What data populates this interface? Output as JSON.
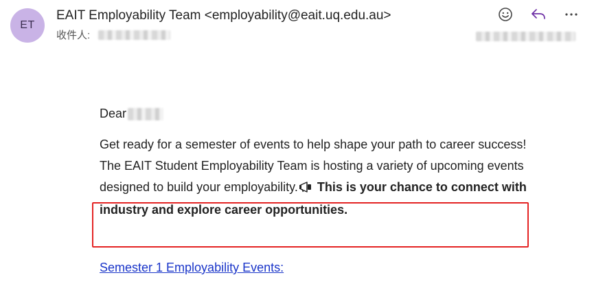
{
  "header": {
    "avatar_initials": "ET",
    "avatar_color": "#c9b3e6",
    "sender": "EAIT Employability Team <employability@eait.uq.edu.au>",
    "recipient_label": "收件人:"
  },
  "toolbar": {
    "icons": [
      "emoji-icon",
      "reply-icon",
      "more-icon"
    ]
  },
  "body": {
    "greeting": "Dear",
    "intro": "Get ready for a semester of events to help shape your path to career success! The EAIT Student Employability Team is hosting a variety of upcoming events designed to build your employability.",
    "emphasis": "This is your chance to connect with industry and explore career opportunities.",
    "link_text": "Semester 1 Employability Events:"
  },
  "colors": {
    "highlight_border": "#e42323",
    "link": "#1a35c9"
  }
}
